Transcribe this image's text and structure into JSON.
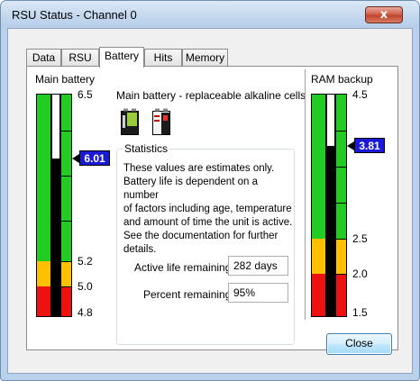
{
  "window": {
    "title": "RSU Status - Channel 0",
    "close_glyph": "x"
  },
  "tabs": [
    {
      "label": "Data"
    },
    {
      "label": "RSU"
    },
    {
      "label": "Battery"
    },
    {
      "label": "Hits"
    },
    {
      "label": "Memory"
    }
  ],
  "active_tab": "Battery",
  "main_battery": {
    "label": "Main battery",
    "scale": [
      "6.5",
      "5.2",
      "5.0",
      "4.8"
    ],
    "current_value": "6.01",
    "level": {
      "min": 4.8,
      "max": 6.5,
      "value": 6.01
    },
    "colors": {
      "green": "#22cc22",
      "yellow": "#ffc000",
      "red": "#ee1111"
    }
  },
  "battery_description": "Main battery - replaceable alkaline cells",
  "battery_icons": [
    "battery-9v-icon",
    "battery-9v-alt-icon"
  ],
  "statistics": {
    "title": "Statistics",
    "text_lines": [
      "These values are estimates only.",
      "Battery life is dependent on a number",
      "of factors including age, temperature",
      "and amount of time the unit is active.",
      "See the documentation for further",
      "details."
    ],
    "active_life_label": "Active life remaining:",
    "active_life_value": "282 days",
    "percent_label": "Percent remaining:",
    "percent_value": "95%"
  },
  "ram_backup": {
    "label": "RAM backup",
    "scale": [
      "4.5",
      "2.5",
      "2.0",
      "1.5"
    ],
    "current_value": "3.81",
    "level": {
      "min": 1.5,
      "max": 4.5,
      "value": 3.81
    }
  },
  "close_button": {
    "label": "Close"
  }
}
